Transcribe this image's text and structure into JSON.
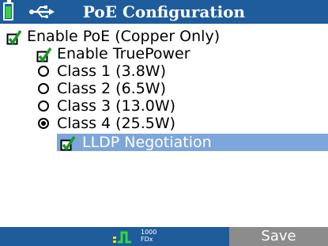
{
  "header": {
    "title": "PoE Configuration",
    "battery_icon": "battery-icon",
    "usb_icon": "usb-icon",
    "color": "#1e5c9b"
  },
  "options": {
    "enable_poe": {
      "label": "Enable PoE (Copper Only)",
      "checked": true
    },
    "enable_truepower": {
      "label": "Enable TruePower",
      "checked": true
    },
    "classes": [
      {
        "label": "Class 1 (3.8W)",
        "selected": false
      },
      {
        "label": "Class 2 (6.5W)",
        "selected": false
      },
      {
        "label": "Class 3 (13.0W)",
        "selected": false
      },
      {
        "label": "Class 4 (25.5W)",
        "selected": true
      }
    ],
    "lldp": {
      "label": "LLDP Negotiation",
      "checked": true,
      "highlighted": true
    }
  },
  "footer": {
    "speed": "1000",
    "duplex": "FDx",
    "link_icon": "link-pulse-icon",
    "save_label": "Save"
  }
}
